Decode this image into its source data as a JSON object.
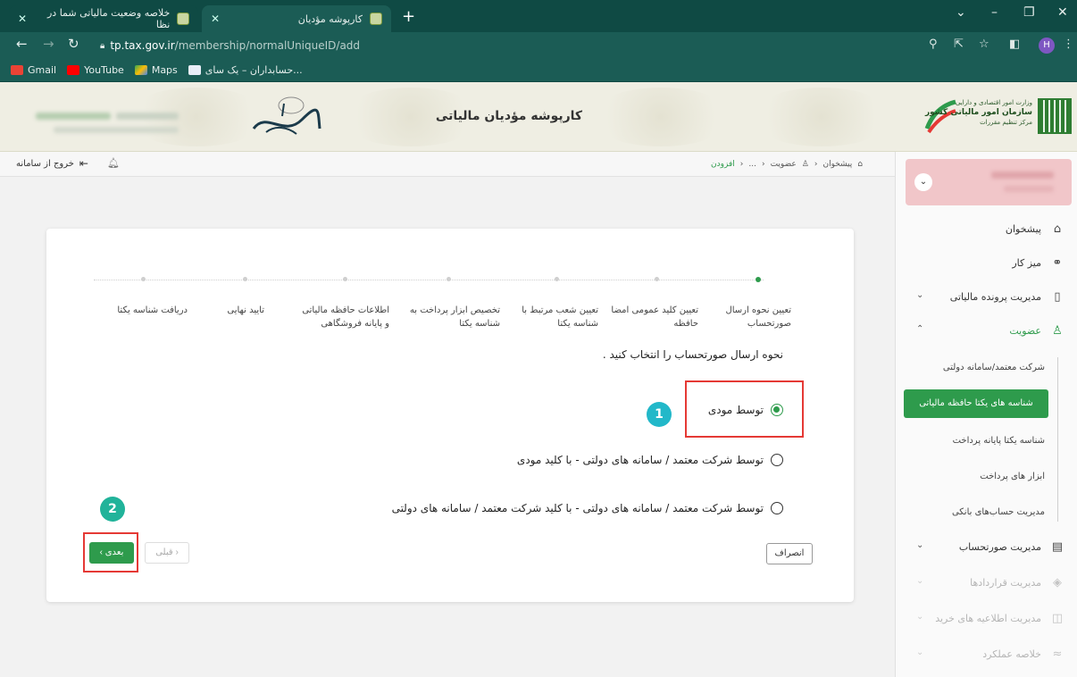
{
  "browser": {
    "tabs": [
      {
        "title": "خلاصه وضعیت مالیاتی شما در نظا"
      },
      {
        "title": "کارپوشه مؤدیان"
      }
    ],
    "new_tab": "+",
    "url_host": "tp.tax.gov.ir",
    "url_path": "/membership/normalUniqueID/add",
    "profile_initial": "H",
    "bookmarks": [
      {
        "label": "Gmail"
      },
      {
        "label": "YouTube"
      },
      {
        "label": "Maps"
      },
      {
        "label": "حسابداران – یک سای..."
      }
    ]
  },
  "header": {
    "site_title": "کارپوشه مؤدیان مالیاتی",
    "logo_line1": "وزارت امور اقتصادی و دارایی",
    "logo_line2": "سازمان امور مالیاتی کشور",
    "logo_line3": "مرکز تنظیم مقررات"
  },
  "topbar": {
    "logout": "خروج از سامانه",
    "breadcrumb": [
      "پیشخوان",
      "عضویت",
      "...",
      "افزودن"
    ]
  },
  "stepper": {
    "steps": [
      "تعیین نحوه ارسال صورتحساب",
      "تعیین کلید عمومی امضا حافظه",
      "تعیین شعب مرتبط با شناسه یکتا",
      "تخصیص ابزار پرداخت به شناسه یکتا",
      "اطلاعات حافظه مالیاتی و پایانه فروشگاهی",
      "تایید نهایی",
      "دریافت شناسه یکتا"
    ]
  },
  "form": {
    "question": "نحوه ارسال صورتحساب را انتخاب کنید .",
    "options": [
      "توسط مودی",
      "توسط شرکت معتمد / سامانه های دولتی - با کلید مودی",
      "توسط شرکت معتمد / سامانه های دولتی - با کلید شرکت معتمد / سامانه های دولتی"
    ],
    "selected_index": 0,
    "next": "بعدی ›",
    "prev": "‹ قبلی",
    "cancel": "انصراف",
    "badge1": "1",
    "badge2": "2"
  },
  "sidebar": {
    "items": [
      {
        "label": "پیشخوان",
        "icon": "home-icon"
      },
      {
        "label": "میز کار",
        "icon": "workflow-icon"
      },
      {
        "label": "مدیریت پرونده مالیاتی",
        "icon": "file-icon"
      },
      {
        "label": "عضویت",
        "icon": "user-icon"
      },
      {
        "label": "مدیریت صورتحساب",
        "icon": "invoice-icon"
      },
      {
        "label": "مدیریت قراردادها",
        "icon": "handshake-icon"
      },
      {
        "label": "مدیریت اطلاعیه های خرید",
        "icon": "bag-icon"
      },
      {
        "label": "خلاصه عملکرد",
        "icon": "chart-icon"
      }
    ],
    "sub_items": [
      "شرکت معتمد/سامانه دولتی",
      "شناسه های یکتا حافظه مالیاتی",
      "شناسه یکتا پایانه پرداخت",
      "ابزار های پرداخت",
      "مدیریت حساب‌های بانکی"
    ]
  },
  "colors": {
    "brand_green": "#2e9b4c",
    "browser_dark": "#0f4a44",
    "highlight_red": "#e53935",
    "badge_teal": "#22b8c9"
  }
}
